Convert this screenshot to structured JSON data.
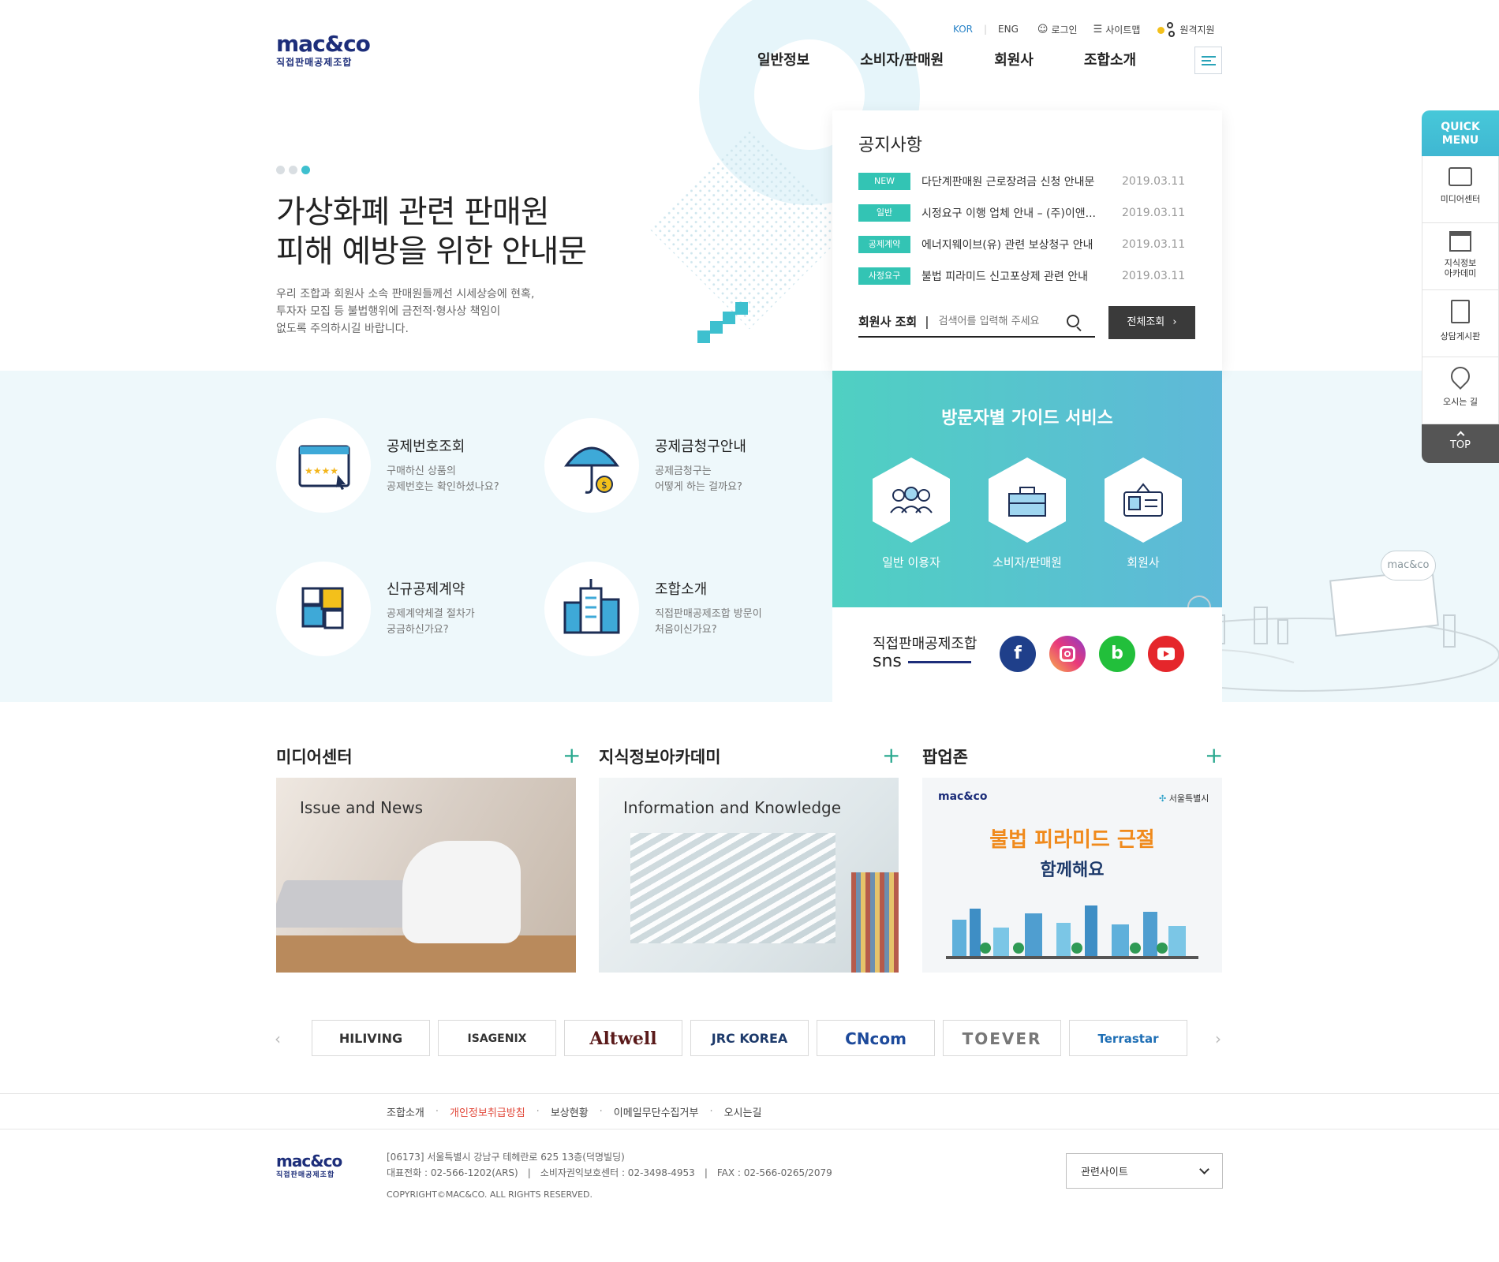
{
  "header": {
    "logo_text": "mac&co",
    "logo_sub": "직접판매공제조합",
    "util": {
      "kor": "KOR",
      "eng": "ENG",
      "login": "로그인",
      "sitemap": "사이트맵",
      "remote": "원격지원"
    },
    "gnb": [
      "일반정보",
      "소비자/판매원",
      "회원사",
      "조합소개"
    ]
  },
  "hero": {
    "title_line1": "가상화폐 관련 판매원",
    "title_line2": "피해 예방을 위한 안내문",
    "desc_line1": "우리 조합과 회원사 소속 판매원들께선 시세상승에 현혹,",
    "desc_line2": "투자자 모집 등 불법행위에 금전적·형사상 책임이",
    "desc_line3": "없도록 주의하시길 바랍니다."
  },
  "notice": {
    "title": "공지사항",
    "items": [
      {
        "badge": "NEW",
        "text": "다단계판매원 근로장려금 신청 안내문",
        "date": "2019.03.11"
      },
      {
        "badge": "일반",
        "text": "시정요구 이행 업체 안내 – (주)이앤...",
        "date": "2019.03.11"
      },
      {
        "badge": "공제계약",
        "text": "에너지웨이브(유) 관련 보상청구 안내",
        "date": "2019.03.11"
      },
      {
        "badge": "사정요구",
        "text": "불법 피라미드 신고포상제 관련 안내",
        "date": "2019.03.11"
      }
    ],
    "search_label": "회원사 조회",
    "search_placeholder": "검색어를 입력해 주세요",
    "view_all": "전체조회"
  },
  "services": [
    {
      "title": "공제번호조회",
      "desc1": "구매하신 상품의",
      "desc2": "공제번호는 확인하셨나요?"
    },
    {
      "title": "공제금청구안내",
      "desc1": "공제금청구는",
      "desc2": "어떻게 하는 걸까요?"
    },
    {
      "title": "신규공제계약",
      "desc1": "공제계약체결 절차가",
      "desc2": "궁금하신가요?"
    },
    {
      "title": "조합소개",
      "desc1": "직접판매공제조합 방문이",
      "desc2": "처음이신가요?"
    }
  ],
  "guide": {
    "title": "방문자별 가이드 서비스",
    "items": [
      "일반 이용자",
      "소비자/판매원",
      "회원사"
    ]
  },
  "sns": {
    "title": "직접판매공제조합",
    "sub": "sns",
    "fb": "f",
    "blog": "b"
  },
  "watermark": "mac&co",
  "sections": {
    "media": {
      "title": "미디어센터",
      "caption": "Issue and News"
    },
    "academy": {
      "title": "지식정보아카데미",
      "caption": "Information and Knowledge"
    },
    "popup": {
      "title": "팝업존",
      "seoul": "서울특별시",
      "line1": "불법 피라미드 근절",
      "line2": "함께해요"
    }
  },
  "partners": [
    "HILIVING",
    "ISAGENIX",
    "Altwell",
    "JRC KOREA",
    "CNcom",
    "TOEVER",
    "Terrastar"
  ],
  "footer": {
    "links": [
      "조합소개",
      "개인정보취급방침",
      "보상현황",
      "이메일무단수집거부",
      "오시는길"
    ],
    "address": "[06173] 서울특별시 강남구 테헤란로 625 13층(덕명빌딩)",
    "phone": "대표전화 : 02-566-1202(ARS)　|　소비자권익보호센터 : 02-3498-4953　|　FAX : 02-566-0265/2079",
    "copyright": "COPYRIGHT©MAC&CO. ALL RIGHTS RESERVED.",
    "related": "관련사이트"
  },
  "quick": {
    "head1": "QUICK",
    "head2": "MENU",
    "items": [
      "미디어센터",
      "지식정보",
      "아카데미",
      "상담게시판",
      "오시는 길"
    ],
    "top": "TOP"
  },
  "colors": {
    "accent": "#33c4b4",
    "navy": "#1d2e7a",
    "guide_start": "#4fd0c2",
    "guide_end": "#5fb8d9"
  }
}
